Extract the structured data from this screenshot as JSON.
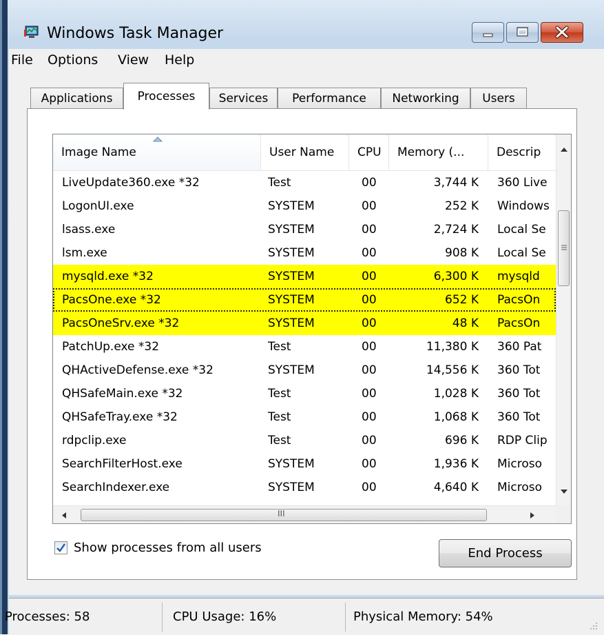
{
  "window": {
    "title": "Windows Task Manager"
  },
  "menu": [
    "File",
    "Options",
    "View",
    "Help"
  ],
  "tabs": [
    {
      "label": "Applications"
    },
    {
      "label": "Processes",
      "active": true
    },
    {
      "label": "Services"
    },
    {
      "label": "Performance"
    },
    {
      "label": "Networking"
    },
    {
      "label": "Users"
    }
  ],
  "columns": [
    "Image Name",
    "User Name",
    "CPU",
    "Memory (...",
    "Descrip"
  ],
  "processes": [
    {
      "name": "LiveUpdate360.exe *32",
      "user": "Test",
      "cpu": "00",
      "mem": "3,744 K",
      "desc": "360 Live"
    },
    {
      "name": "LogonUI.exe",
      "user": "SYSTEM",
      "cpu": "00",
      "mem": "252 K",
      "desc": "Windows"
    },
    {
      "name": "lsass.exe",
      "user": "SYSTEM",
      "cpu": "00",
      "mem": "2,724 K",
      "desc": "Local Se"
    },
    {
      "name": "lsm.exe",
      "user": "SYSTEM",
      "cpu": "00",
      "mem": "908 K",
      "desc": "Local Se"
    },
    {
      "name": "mysqld.exe *32",
      "user": "SYSTEM",
      "cpu": "00",
      "mem": "6,300 K",
      "desc": "mysqld",
      "highlighted": true
    },
    {
      "name": "PacsOne.exe *32",
      "user": "SYSTEM",
      "cpu": "00",
      "mem": "652 K",
      "desc": "PacsOn",
      "highlighted": true,
      "selected": true
    },
    {
      "name": "PacsOneSrv.exe *32",
      "user": "SYSTEM",
      "cpu": "00",
      "mem": "48 K",
      "desc": "PacsOn",
      "highlighted": true
    },
    {
      "name": "PatchUp.exe *32",
      "user": "Test",
      "cpu": "00",
      "mem": "11,380 K",
      "desc": "360 Pat"
    },
    {
      "name": "QHActiveDefense.exe *32",
      "user": "SYSTEM",
      "cpu": "00",
      "mem": "14,556 K",
      "desc": "360 Tot"
    },
    {
      "name": "QHSafeMain.exe *32",
      "user": "Test",
      "cpu": "00",
      "mem": "1,028 K",
      "desc": "360 Tot"
    },
    {
      "name": "QHSafeTray.exe *32",
      "user": "Test",
      "cpu": "00",
      "mem": "1,068 K",
      "desc": "360 Tot"
    },
    {
      "name": "rdpclip.exe",
      "user": "Test",
      "cpu": "00",
      "mem": "696 K",
      "desc": "RDP Clip"
    },
    {
      "name": "SearchFilterHost.exe",
      "user": "SYSTEM",
      "cpu": "00",
      "mem": "1,936 K",
      "desc": "Microso"
    },
    {
      "name": "SearchIndexer.exe",
      "user": "SYSTEM",
      "cpu": "00",
      "mem": "4,640 K",
      "desc": "Microso"
    }
  ],
  "hscroll_label": "III",
  "show_all_users": {
    "label": "Show processes from all users",
    "checked": true
  },
  "end_process_label": "End Process",
  "status": {
    "processes": "Processes: 58",
    "cpu": "CPU Usage: 16%",
    "memory": "Physical Memory: 54%"
  },
  "colors": {
    "highlight": "#ffff00",
    "close_button": "#c0391c",
    "check_mark": "#2a5fb0"
  },
  "icons": [
    "task-manager-app-icon",
    "minimize-icon",
    "maximize-icon",
    "close-icon",
    "sort-ascending-icon",
    "scroll-up-icon",
    "scroll-down-icon",
    "scroll-left-icon",
    "scroll-right-icon",
    "checkmark-icon",
    "size-grip-icon"
  ]
}
